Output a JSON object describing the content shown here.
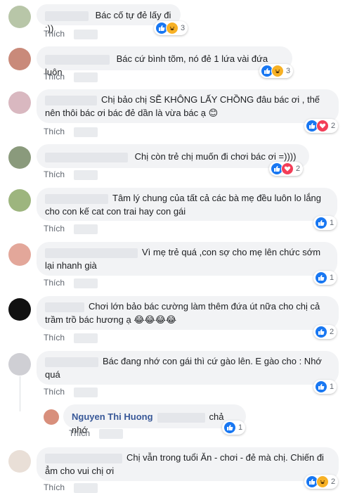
{
  "comments": [
    {
      "text": "Bác cố tự đẻ lấy đi :))",
      "action": "Thích",
      "reactions": [
        "like",
        "haha"
      ],
      "count": "3"
    },
    {
      "text": "Bác cứ bình tõm, nó đẻ 1 lứa vài đứa luôn",
      "action": "Thích",
      "reactions": [
        "like",
        "haha"
      ],
      "count": "3"
    },
    {
      "text_line1": "Chị bảo chị SẼ KHÔNG LẤY CHỒNG đâu bác ơi , thế",
      "text_line2": "nên thôi bác ơi bác đẻ dần là vừa bác ạ 😊",
      "action": "Thích",
      "reactions": [
        "like",
        "love"
      ],
      "count": "2"
    },
    {
      "text": "Chị còn trẻ chị muốn đi chơi bác ơi =))))",
      "action": "Thích",
      "reactions": [
        "like",
        "love"
      ],
      "count": "2"
    },
    {
      "text_line1": "Tâm lý chung của tất cả các bà mẹ đều luôn lo lắng",
      "text_line2": "cho con kế cat con trai hay con gái",
      "action": "Thích",
      "reactions": [
        "like"
      ],
      "count": "1"
    },
    {
      "text_line1": "Vì mẹ trẻ quá ,con sợ cho mẹ lên chức sớm",
      "text_line2": "lại nhanh già",
      "action": "Thích",
      "reactions": [
        "like"
      ],
      "count": "1"
    },
    {
      "text_line1": "Chơi lớn bảo bác cường làm thêm đứa út nữa cho chị cả",
      "text_line2": "trầm trồ bác hương ạ 😂😂😂😂",
      "action": "Thích",
      "reactions": [
        "like"
      ],
      "count": "2"
    },
    {
      "text_line1": "Bác đang nhớ con gái thì cứ gào lên. E gào cho : Nhớ",
      "text_line2": "quá",
      "action": "Thích",
      "reactions": [
        "like"
      ],
      "count": "1"
    },
    {
      "reply_name": "Nguyen Thi Huong",
      "text": "chả nhớ",
      "action": "Thích",
      "reactions": [
        "like"
      ],
      "count": "1"
    },
    {
      "text_line1": "Chị vẫn trong tuổi Ăn - chơi - đẻ mà chị. Chiến đi",
      "text_line2": "ẳm cho vui chị ơi",
      "action": "Thích",
      "reactions": [
        "like",
        "haha"
      ],
      "count": "2"
    }
  ],
  "icons": {
    "like": "thumbs-up-icon",
    "haha": "laughing-face-icon",
    "love": "heart-icon"
  },
  "colors": {
    "bubble": "#f2f3f5",
    "like": "#1877f2",
    "haha": "#f7b125",
    "love": "#f33e58",
    "link": "#616770",
    "name": "#385898"
  }
}
